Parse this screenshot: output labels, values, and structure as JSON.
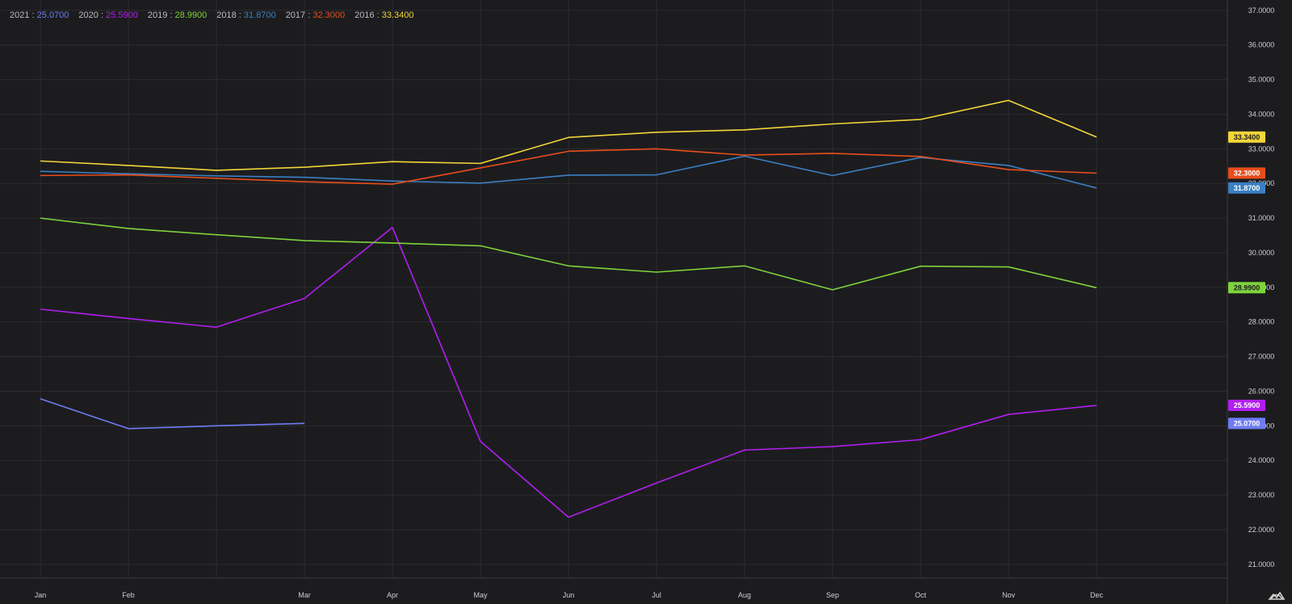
{
  "chart_data": {
    "type": "line",
    "categories": [
      "Jan",
      "Feb",
      "Mar",
      "Apr",
      "May",
      "Jun",
      "Jul",
      "Aug",
      "Sep",
      "Oct",
      "Nov",
      "Dec"
    ],
    "x_tick_labels": [
      "Jan",
      "Feb",
      "Mar",
      "Apr",
      "May",
      "Jun",
      "Jul",
      "Aug",
      "Sep",
      "Oct",
      "Nov",
      "Dec"
    ],
    "y_tick_labels": [
      "21.0000",
      "22.0000",
      "23.0000",
      "24.0000",
      "25.0000",
      "26.0000",
      "27.0000",
      "28.0000",
      "29.0000",
      "30.0000",
      "31.0000",
      "32.0000",
      "33.0000",
      "34.0000",
      "35.0000",
      "36.0000",
      "37.0000"
    ],
    "ylim": [
      20.6,
      37.3
    ],
    "grid": true,
    "legend_placement": "top-left",
    "series": [
      {
        "name": "2021",
        "last_label": "25.0700",
        "color": "#6f7cf2",
        "x": [
          0,
          1,
          2,
          3
        ],
        "values": [
          25.78,
          24.92,
          25.0,
          25.07
        ]
      },
      {
        "name": "2020",
        "last_label": "25.5900",
        "color": "#b21ef0",
        "x": [
          0,
          1,
          2,
          3,
          4,
          5,
          6,
          7,
          8,
          9,
          10,
          11,
          12
        ],
        "values": [
          28.37,
          28.1,
          27.85,
          28.68,
          30.73,
          24.55,
          22.36,
          23.35,
          24.3,
          24.4,
          24.6,
          25.33,
          25.59
        ]
      },
      {
        "name": "2019",
        "last_label": "28.9900",
        "color": "#7ed33c",
        "x": [
          0,
          1,
          2,
          3,
          4,
          5,
          6,
          7,
          8,
          9,
          10,
          11,
          12
        ],
        "values": [
          31.0,
          30.7,
          30.52,
          30.35,
          30.28,
          30.2,
          29.62,
          29.44,
          29.62,
          28.93,
          29.61,
          29.59,
          28.99
        ]
      },
      {
        "name": "2018",
        "last_label": "31.8700",
        "color": "#3b7fc2",
        "x": [
          0,
          1,
          2,
          3,
          4,
          5,
          6,
          7,
          8,
          9,
          10,
          11,
          12
        ],
        "values": [
          32.35,
          32.28,
          32.22,
          32.18,
          32.07,
          32.01,
          32.24,
          32.25,
          32.79,
          32.23,
          32.75,
          32.52,
          31.87
        ]
      },
      {
        "name": "2017",
        "last_label": "32.3000",
        "color": "#e84e1c",
        "x": [
          0,
          1,
          2,
          3,
          4,
          5,
          6,
          7,
          8,
          9,
          10,
          11,
          12
        ],
        "values": [
          32.23,
          32.25,
          32.15,
          32.05,
          31.98,
          32.45,
          32.93,
          33.0,
          32.82,
          32.87,
          32.78,
          32.4,
          32.3
        ]
      },
      {
        "name": "2016",
        "last_label": "33.3400",
        "color": "#f2d53a",
        "x": [
          0,
          1,
          2,
          3,
          4,
          5,
          6,
          7,
          8,
          9,
          10,
          11,
          12
        ],
        "values": [
          32.65,
          32.52,
          32.38,
          32.47,
          32.63,
          32.58,
          33.33,
          33.48,
          33.55,
          33.72,
          33.85,
          34.4,
          33.34
        ]
      }
    ]
  }
}
